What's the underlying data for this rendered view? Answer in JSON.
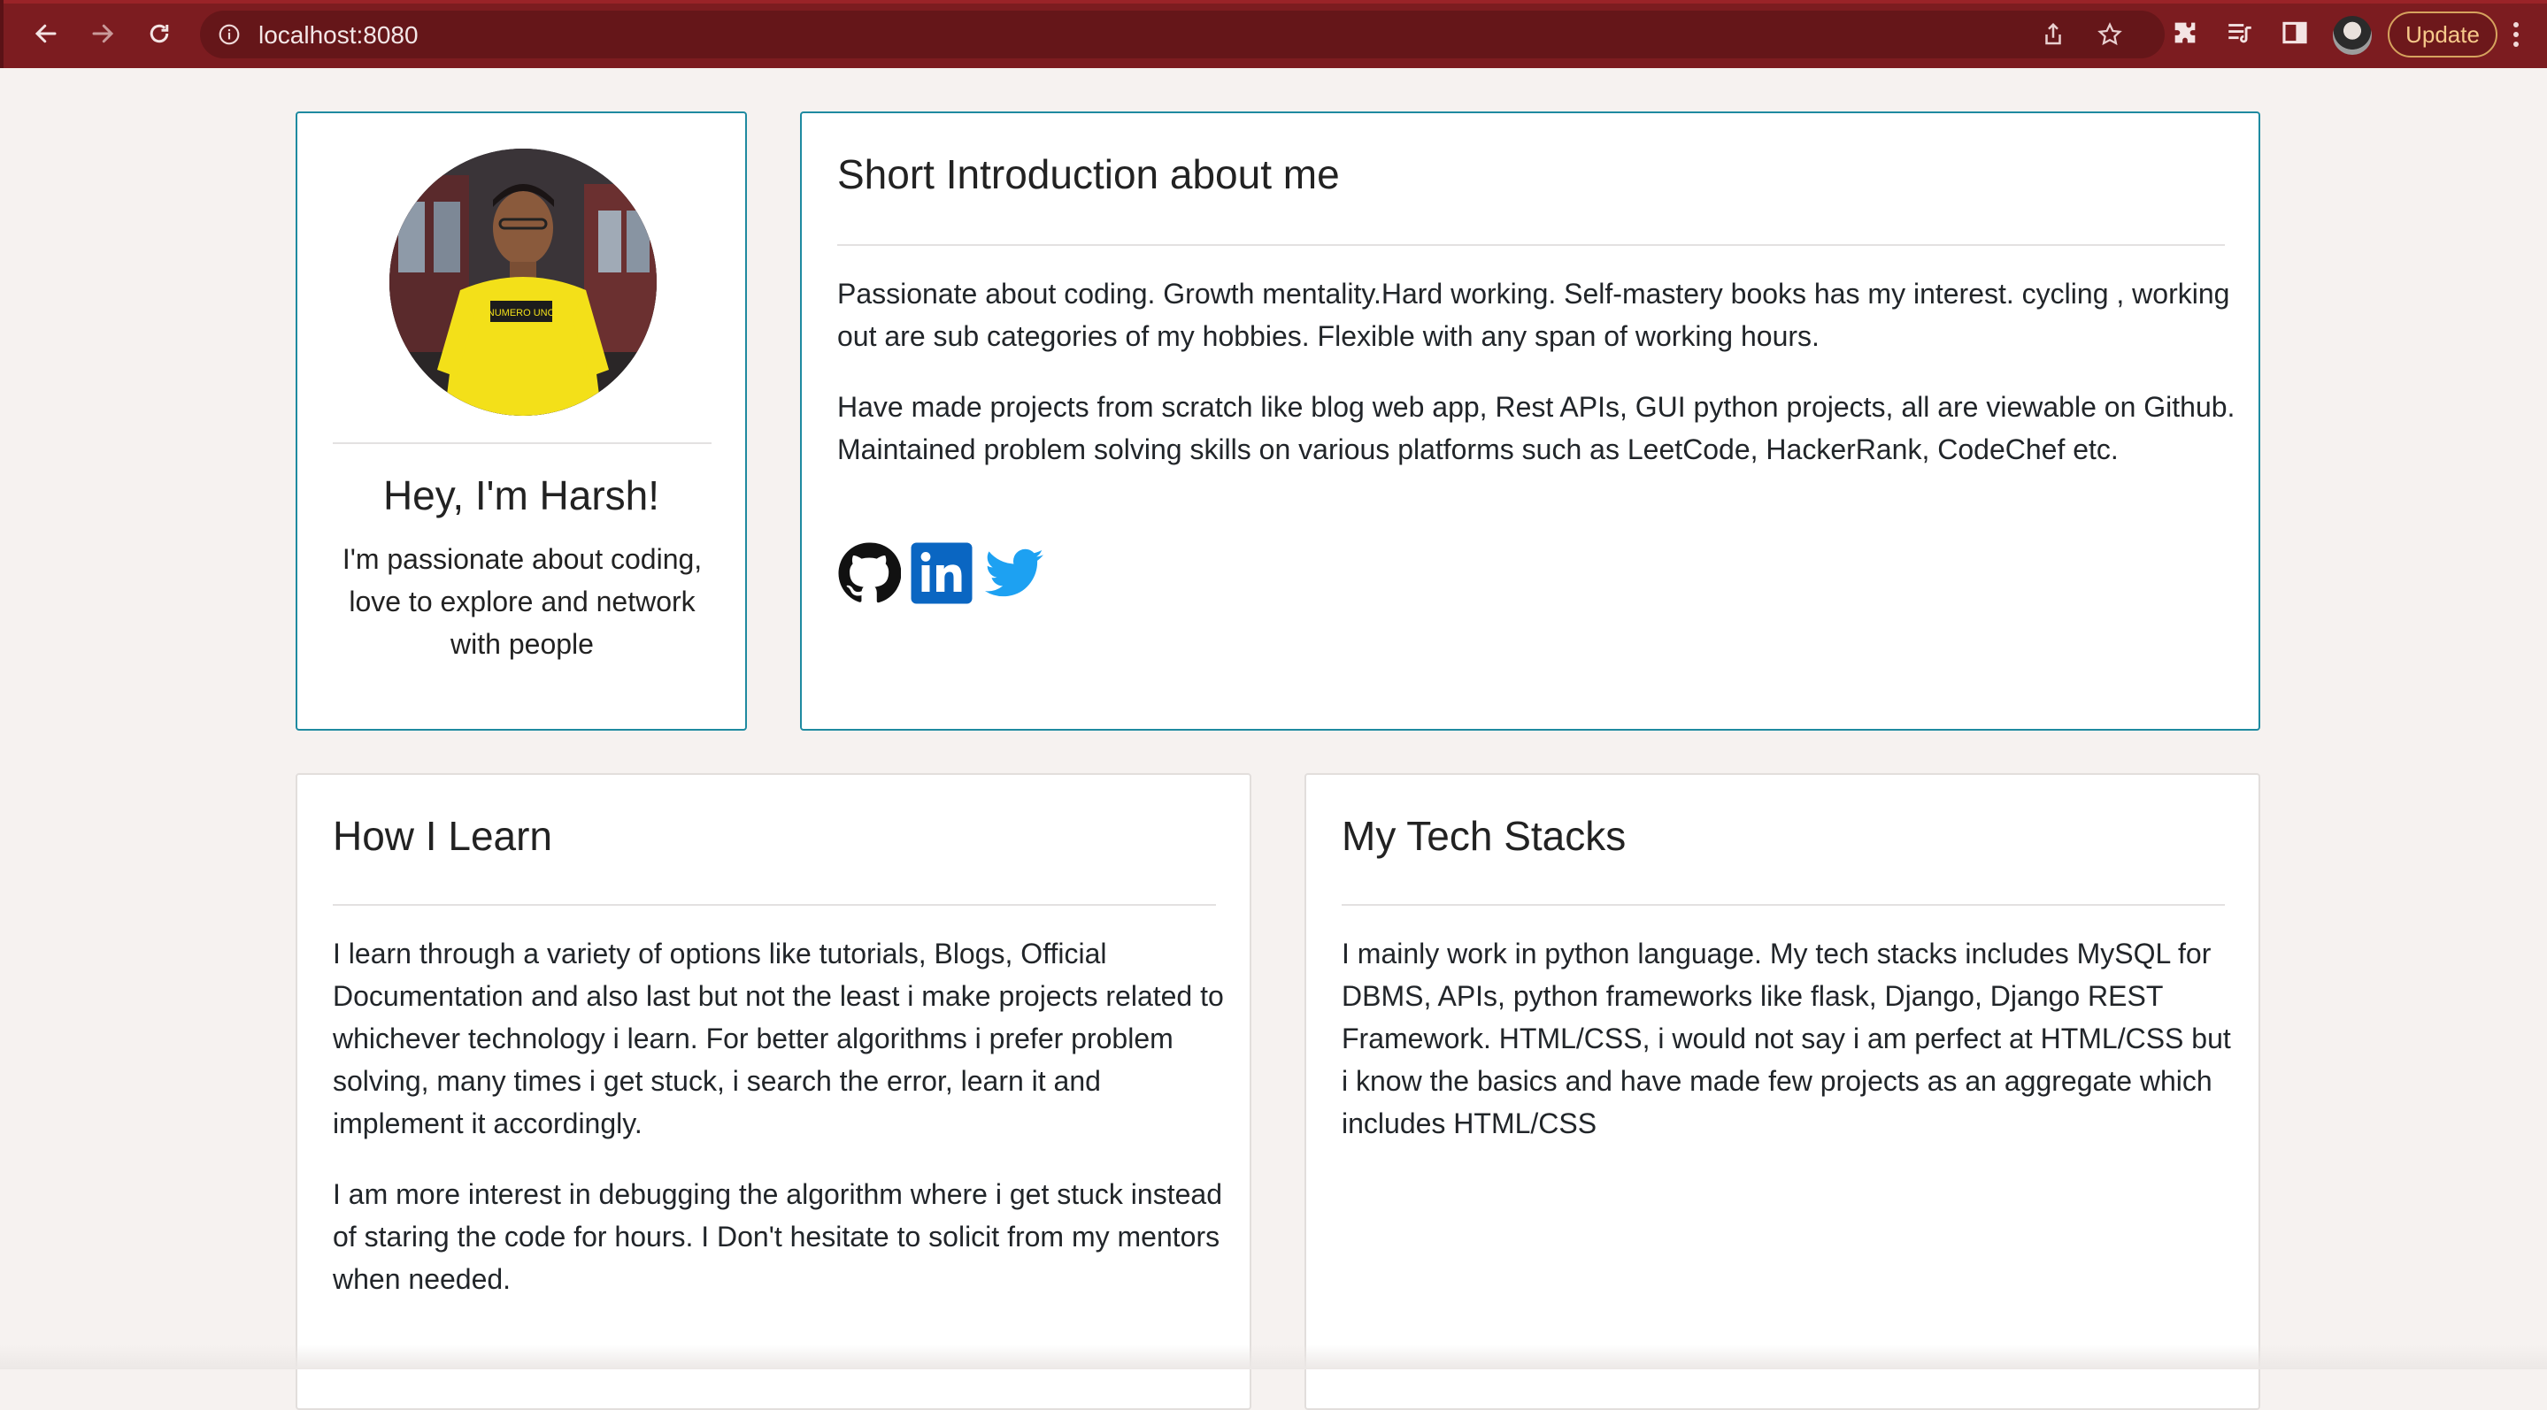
{
  "browser": {
    "url": "localhost:8080",
    "update_label": "Update",
    "chrome_color": "#7c1c20"
  },
  "profile": {
    "greeting": "Hey, I'm Harsh!",
    "tagline": "I'm passionate about coding, love to explore and network with people",
    "shirt_text": "NUMERO UNO"
  },
  "intro": {
    "title": "Short Introduction about me",
    "para1": "Passionate about coding. Growth mentality.Hard working. Self-mastery books has my interest. cycling , working out are sub categories of my hobbies. Flexible with any span of working hours.",
    "para2": "Have made projects from scratch like blog web app, Rest APIs, GUI python projects, all are viewable on Github. Maintained problem solving skills on various platforms such as LeetCode, HackerRank, CodeChef etc.",
    "social": [
      "github-icon",
      "linkedin-icon",
      "twitter-icon"
    ]
  },
  "learn": {
    "title": "How I Learn",
    "para1": "I learn through a variety of options like tutorials, Blogs, Official Documentation and also last but not the least i make projects related to whichever technology i learn. For better algorithms i prefer problem solving, many times i get stuck, i search the error, learn it and implement it accordingly.",
    "para2": "I am more interest in debugging the algorithm where i get stuck instead of staring the code for hours. I Don't hesitate to solicit from my mentors when needed."
  },
  "tech": {
    "title": "My Tech Stacks",
    "para1": "I mainly work in python language. My tech stacks includes MySQL for DBMS, APIs, python frameworks like flask, Django, Django REST Framework. HTML/CSS, i would not say i am perfect at HTML/CSS but i know the basics and have made few projects as an aggregate which includes HTML/CSS"
  },
  "colors": {
    "card_border_accent": "#1f8aa0",
    "linkedin": "#0a66c2",
    "twitter": "#1da1f2"
  }
}
